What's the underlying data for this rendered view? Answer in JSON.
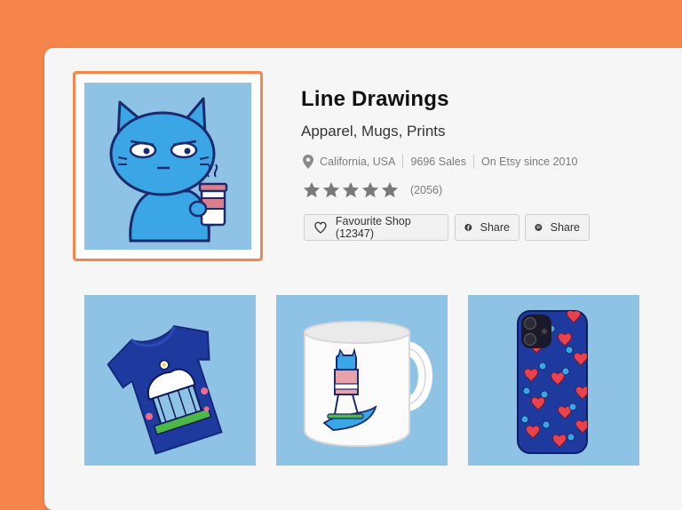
{
  "shop": {
    "title": "Line Drawings",
    "subtitle": "Apparel, Mugs, Prints",
    "location": "California, USA",
    "sales": "9696 Sales",
    "since": "On Etsy since 2010",
    "rating_stars": 5,
    "review_count": "(2056)"
  },
  "buttons": {
    "favourite_label": "Favourite Shop (12347)",
    "facebook_share_label": "Share",
    "pinterest_share_label": "Share"
  },
  "products": [
    {
      "name": "t-shirt"
    },
    {
      "name": "mug"
    },
    {
      "name": "phone-case"
    }
  ],
  "colors": {
    "background": "#F5854A",
    "card": "#F6F6F6",
    "accent_border": "#F5854A",
    "tile_bg": "#8EC3E6",
    "cat_blue": "#3AA6E6",
    "navy": "#1E3A9E"
  },
  "icons": {
    "location": "map-pin-icon",
    "favourite": "heart-icon",
    "facebook": "facebook-icon",
    "pinterest": "pinterest-icon",
    "rating": "star-icon"
  }
}
